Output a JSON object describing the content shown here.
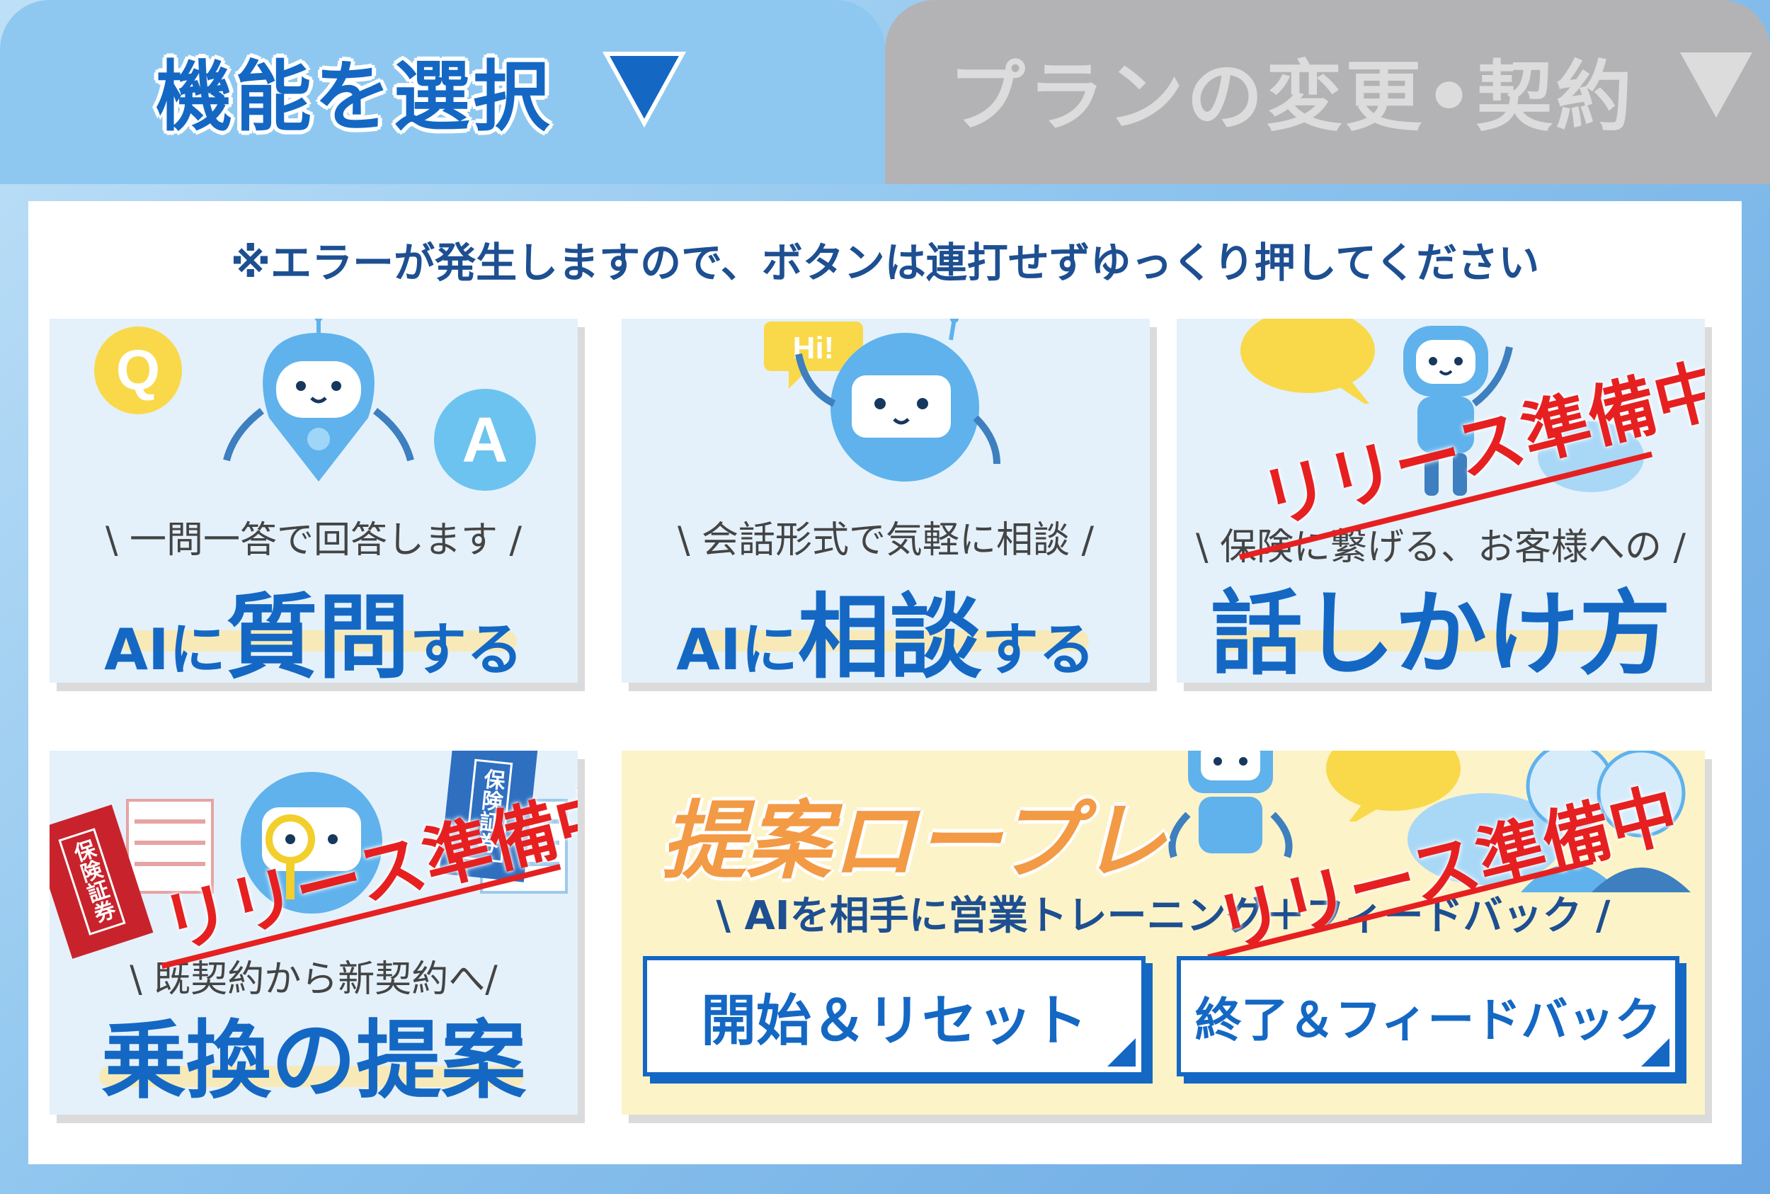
{
  "tabs": {
    "active_label": "機能を選択",
    "inactive_label": "プランの変更•契約",
    "arrow": "▼"
  },
  "notice": "※エラーが発生しますので、ボタンは連打せずゆっくり押してください",
  "cards": {
    "question": {
      "sub": "\\ 一問一答で回答します /",
      "pre": "AIに",
      "big": "質問",
      "post": "する",
      "q": "Q",
      "a": "A"
    },
    "consult": {
      "sub": "\\ 会話形式で気軽に相談 /",
      "pre": "AIに",
      "big": "相談",
      "post": "する",
      "hi": "Hi!"
    },
    "talk": {
      "sub": "\\ 保険に繋げる、お客様への /",
      "big": "話しかけ方"
    },
    "switch": {
      "sub": "\\ 既契約から新契約へ/",
      "big": "乗換の提案",
      "doc1": "保険証券",
      "doc2": "保険証券"
    },
    "roleplay": {
      "title": "提案ロープレ",
      "sub": "\\ AIを相手に営業トレーニング＋フィードバック /"
    }
  },
  "stamp": "リリース準備中",
  "buttons": {
    "start_reset": "開始＆リセット",
    "end_feedback": "終了＆フィードバック"
  },
  "colors": {
    "primary": "#1468c4",
    "stamp": "#e62020",
    "roleplay_title": "#f39a45"
  }
}
